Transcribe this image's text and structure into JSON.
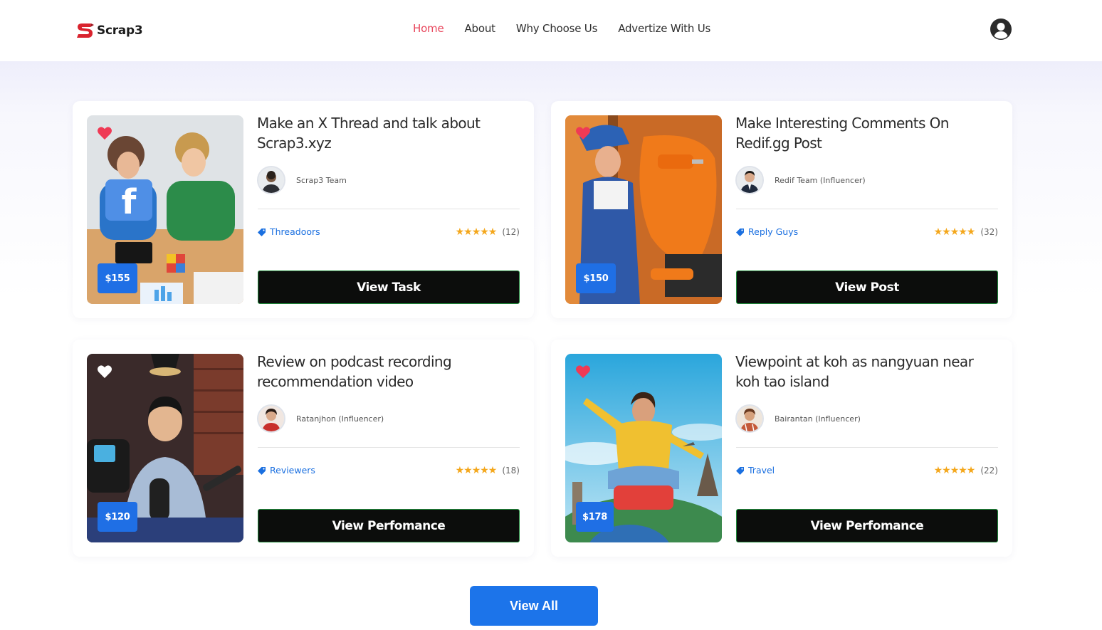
{
  "brand": {
    "name": "Scrap3",
    "accent": "#e8465c"
  },
  "nav": {
    "items": [
      {
        "label": "Home",
        "active": true
      },
      {
        "label": "About",
        "active": false
      },
      {
        "label": "Why Choose Us",
        "active": false
      },
      {
        "label": "Advertize With Us",
        "active": false
      }
    ]
  },
  "user_icon": "user-circle-icon",
  "cards": [
    {
      "title": "Make an X Thread and talk about Scrap3.xyz",
      "author": "Scrap3 Team",
      "tag": "Threadoors",
      "stars": "★★★★★",
      "rating_count": "(12)",
      "price": "$155",
      "favorited": true,
      "button": "View Task"
    },
    {
      "title": "Make Interesting Comments On Redif.gg Post",
      "author": "Redif Team (Influencer)",
      "tag": "Reply Guys",
      "stars": "★★★★★",
      "rating_count": "(32)",
      "price": "$150",
      "favorited": true,
      "button": "View Post"
    },
    {
      "title": "Review on podcast recording recommendation video",
      "author": "Ratanjhon (Influencer)",
      "tag": "Reviewers",
      "stars": "★★★★★",
      "rating_count": "(18)",
      "price": "$120",
      "favorited": false,
      "button": "View Perfomance"
    },
    {
      "title": "Viewpoint at koh as nangyuan near koh tao island",
      "author": "Bairantan (Influencer)",
      "tag": "Travel",
      "stars": "★★★★★",
      "rating_count": "(22)",
      "price": "$178",
      "favorited": true,
      "button": "View Perfomance"
    }
  ],
  "view_all_label": "View All",
  "colors": {
    "price_badge": "#1f6fe5",
    "tag": "#1a6fe0",
    "star": "#f4a71c",
    "button": "#0c0d0c",
    "view_all": "#1c74ea"
  }
}
